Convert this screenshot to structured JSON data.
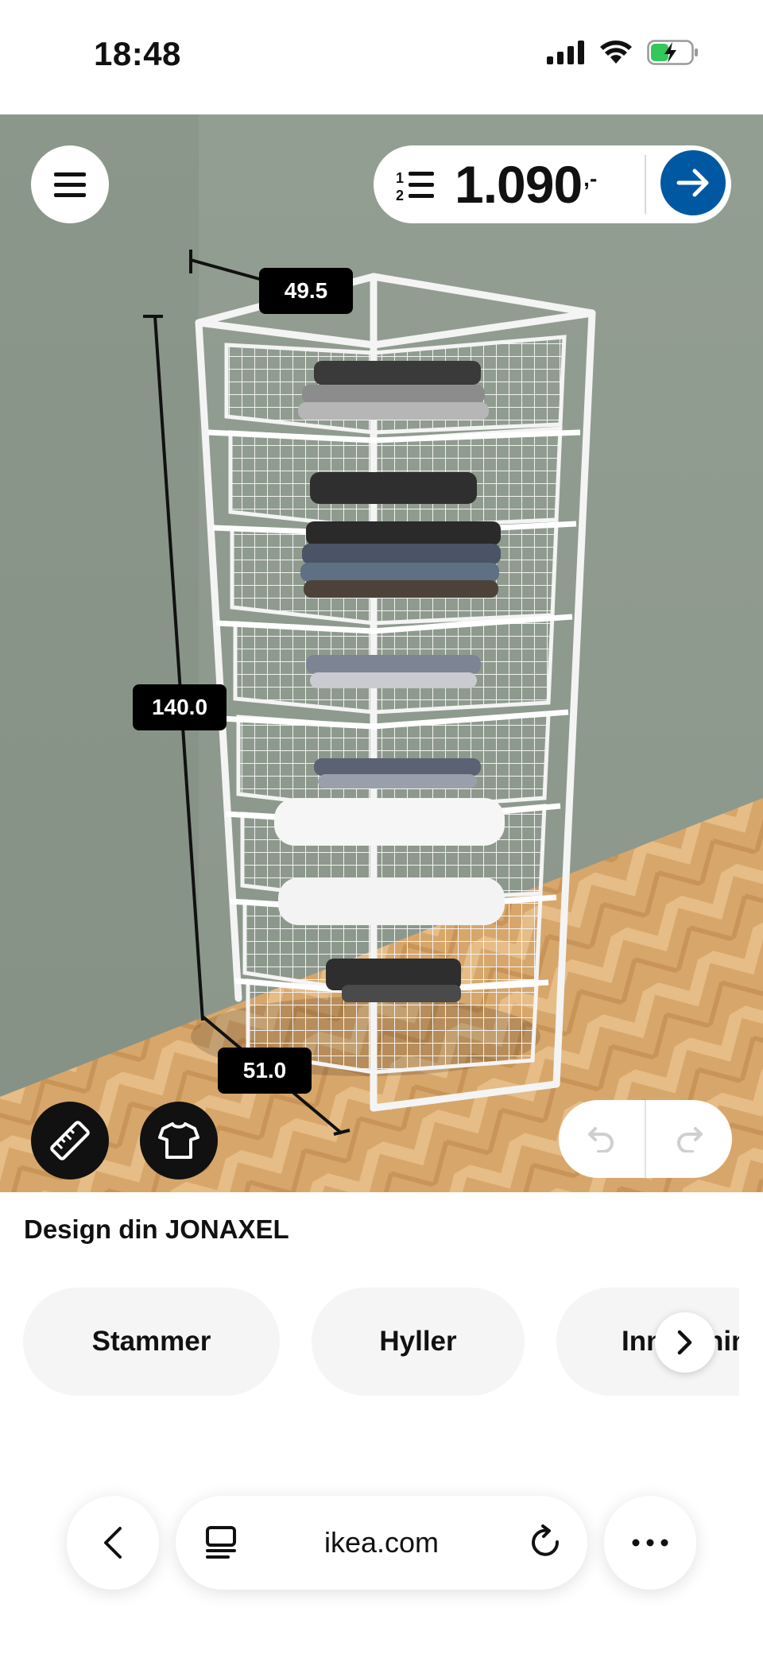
{
  "status_bar": {
    "time": "18:48"
  },
  "toolbar": {
    "price": "1.090",
    "price_suffix": ",-"
  },
  "dimensions": {
    "width": "49.5",
    "height": "140.0",
    "depth": "51.0"
  },
  "design": {
    "title": "Design din JONAXEL",
    "categories": [
      "Stammer",
      "Hyller",
      "Innredning"
    ]
  },
  "browser": {
    "address": "ikea.com"
  },
  "colors": {
    "ikea_blue": "#0058a3",
    "wall": "#8f9a8d",
    "floor": "#d9a96b",
    "chip_bg": "#f5f5f5",
    "battery_green": "#34c759"
  }
}
